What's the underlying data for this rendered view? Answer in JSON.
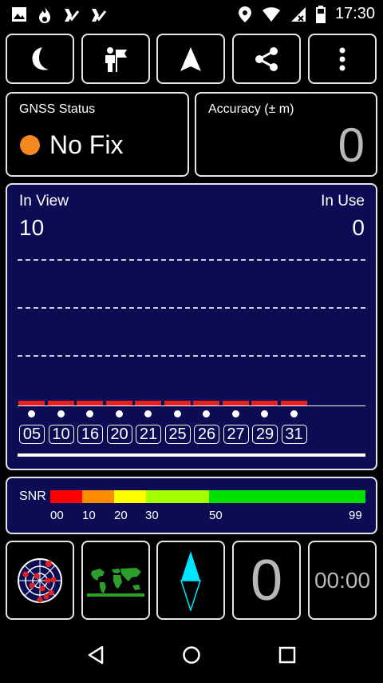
{
  "status_bar": {
    "time": "17:30"
  },
  "gnss": {
    "title": "GNSS Status",
    "status": "No Fix",
    "status_color": "#f5871f"
  },
  "accuracy": {
    "title": "Accuracy (± m)",
    "value": "0"
  },
  "satellites": {
    "in_view_label": "In View",
    "in_view": "10",
    "in_use_label": "In Use",
    "in_use": "0",
    "ids": [
      "05",
      "10",
      "16",
      "20",
      "21",
      "25",
      "26",
      "27",
      "29",
      "31"
    ],
    "bar_color": "#e52020"
  },
  "snr": {
    "title": "SNR",
    "ticks": [
      "00",
      "10",
      "20",
      "30",
      "50",
      "99"
    ],
    "colors": [
      "#ff0000",
      "#ff8c00",
      "#ffff00",
      "#a6ff00",
      "#00e000"
    ]
  },
  "bottom_tiles": {
    "speed": "0",
    "timer": "00:00"
  }
}
